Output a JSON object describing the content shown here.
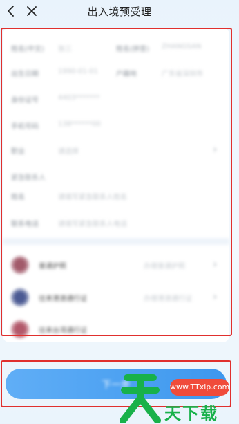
{
  "header": {
    "title": "出入境预受理"
  },
  "form": {
    "row1": {
      "label_a": "姓名(中文)",
      "value_a": "张三",
      "label_b": "姓名(拼音)",
      "value_b": "ZHANGSAN"
    },
    "row2": {
      "label_a": "出生日期",
      "value_a": "1990-01-01",
      "label_b": "户籍地",
      "value_b": "广东省深圳市"
    },
    "row3": {
      "label": "身份证号",
      "value": "4403*******"
    },
    "row4": {
      "label": "手机号码",
      "value": "138******00"
    },
    "row5": {
      "label": "职业",
      "value": "请选择"
    },
    "emergency_title": "紧急联系人",
    "row6": {
      "label": "姓名",
      "value": "请填写紧急联系人姓名"
    },
    "row7": {
      "label": "联系电话",
      "value": "请填写紧急联系人电话"
    }
  },
  "services": [
    {
      "name": "普通护照",
      "desc": "办理普通护照",
      "color": "#a25a6a"
    },
    {
      "name": "往来港澳通行证",
      "desc": "办理港澳通行证",
      "color": "#4b5a93"
    },
    {
      "name": "往来台湾通行证",
      "desc": "办理台湾通行证",
      "color": "#b2586a"
    }
  ],
  "actions": {
    "submit_label": "下一步"
  },
  "watermark": {
    "url": "www.TTxip.com",
    "text": "天下载"
  },
  "colors": {
    "highlight": "#e0302e",
    "primary": "#3d97ee",
    "watermark_green": "#18b14a",
    "watermark_red": "#f04b3a"
  }
}
